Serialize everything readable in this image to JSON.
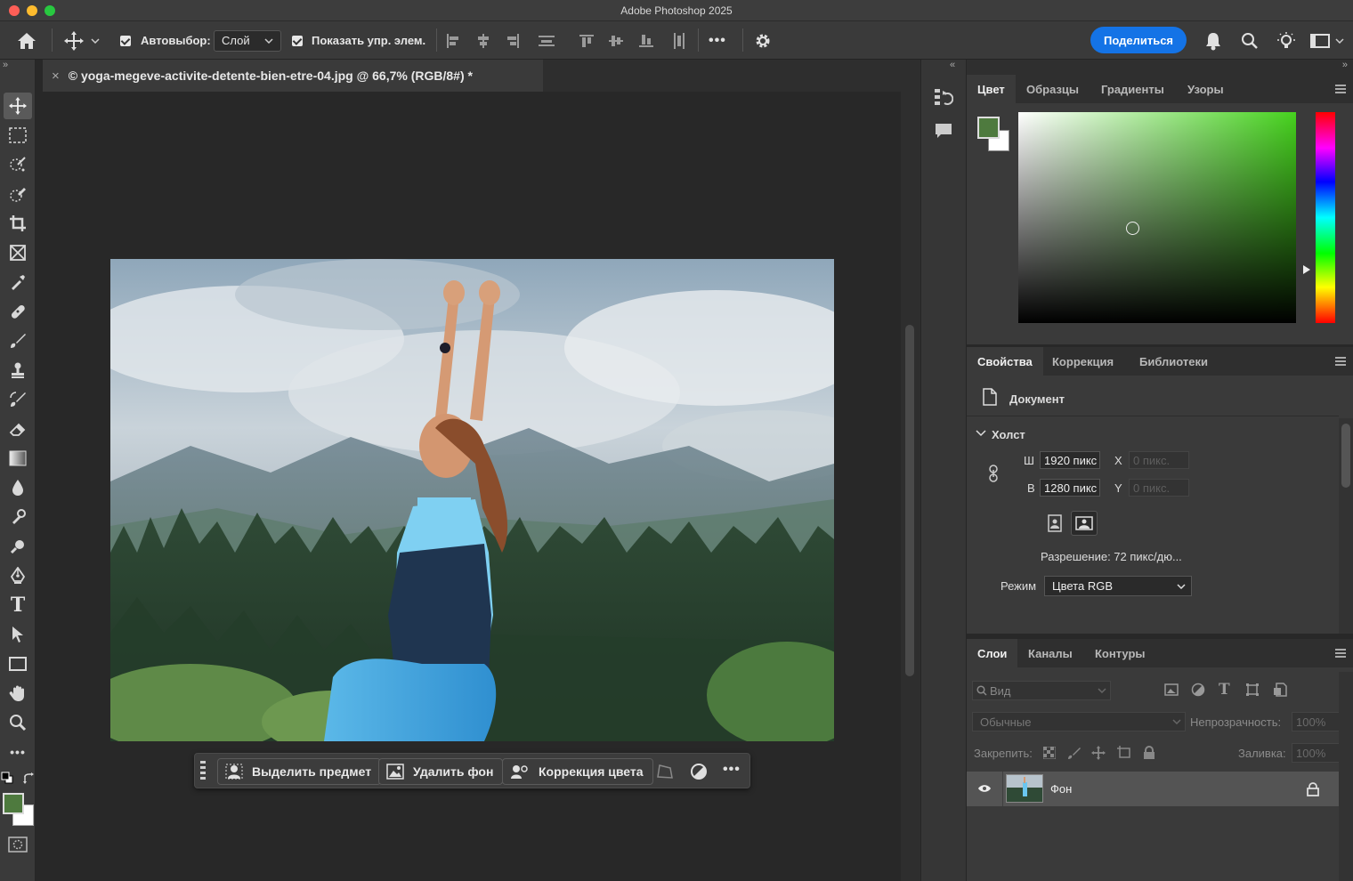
{
  "window": {
    "title": "Adobe Photoshop 2025"
  },
  "options_bar": {
    "auto_select_label": "Автовыбор:",
    "auto_select_value": "Слой",
    "show_transform_label": "Показать упр. элем.",
    "more": "•••",
    "share_label": "Поделиться"
  },
  "document": {
    "tab_title": "© yoga-megeve-activite-detente-bien-etre-04.jpg @ 66,7% (RGB/8#) *",
    "close": "×"
  },
  "context_bar": {
    "select_subject": "Выделить предмет",
    "remove_bg": "Удалить фон",
    "color_correction": "Коррекция цвета",
    "more": "•••"
  },
  "panel_collapse": {
    "left": "«",
    "right": "«",
    "toolbar": "»",
    "far_right": "»"
  },
  "color_panel": {
    "tabs": [
      "Цвет",
      "Образцы",
      "Градиенты",
      "Узоры"
    ],
    "foreground": "#4e7a3e",
    "background": "#ffffff",
    "spectrum_hue": "#46d21e"
  },
  "properties_panel": {
    "tabs": [
      "Свойства",
      "Коррекция",
      "Библиотеки"
    ],
    "document_label": "Документ",
    "canvas_section": "Холст",
    "width_label": "Ш",
    "width_value": "1920 пикс",
    "height_label": "В",
    "height_value": "1280 пикс",
    "x_label": "X",
    "x_value": "0 пикс.",
    "y_label": "Y",
    "y_value": "0 пикс.",
    "resolution": "Разрешение: 72 пикс/дю...",
    "mode_label": "Режим",
    "mode_value": "Цвета RGB"
  },
  "layers_panel": {
    "tabs": [
      "Слои",
      "Каналы",
      "Контуры"
    ],
    "search_placeholder": "Вид",
    "blend_mode": "Обычные",
    "opacity_label": "Непрозрачность:",
    "opacity_value": "100%",
    "lock_label": "Закрепить:",
    "fill_label": "Заливка:",
    "fill_value": "100%",
    "layers": [
      {
        "name": "Фон",
        "visible": true,
        "locked": true
      }
    ]
  },
  "colors": {
    "accent": "#1473e6",
    "panel_bg": "#3a3a3a",
    "canvas_bg": "#282828"
  }
}
